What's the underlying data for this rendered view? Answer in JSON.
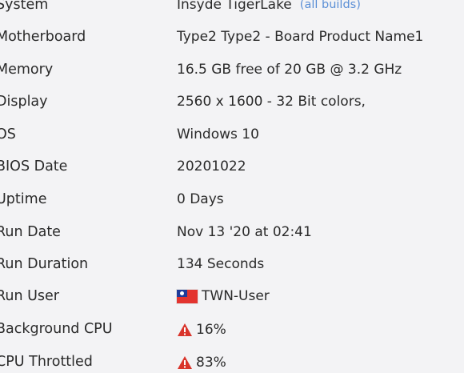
{
  "rows": [
    {
      "label": "System",
      "value": "Insyde TigerLake",
      "link": "(all builds)"
    },
    {
      "label": "Motherboard",
      "value": "Type2 Type2 - Board Product Name1"
    },
    {
      "label": "Memory",
      "value": "16.5 GB free of 20 GB @ 3.2 GHz"
    },
    {
      "label": "Display",
      "value": "2560 x 1600 - 32 Bit colors,"
    },
    {
      "label": "OS",
      "value": "Windows 10"
    },
    {
      "label": "BIOS Date",
      "value": "20201022"
    },
    {
      "label": "Uptime",
      "value": "0 Days"
    },
    {
      "label": "Run Date",
      "value": "Nov 13 '20 at 02:41"
    },
    {
      "label": "Run Duration",
      "value": "134 Seconds"
    },
    {
      "label": "Run User",
      "value": "TWN-User",
      "icon": "taiwan-flag-icon"
    },
    {
      "label": "Background CPU",
      "value": "16%",
      "icon": "warning-icon"
    },
    {
      "label": "CPU Throttled",
      "value": "83%",
      "icon": "warning-icon"
    }
  ],
  "colors": {
    "text": "#2a2a2a",
    "link": "#5b8fd6",
    "warning": "#d9342b",
    "background": "#f3f3f5"
  }
}
